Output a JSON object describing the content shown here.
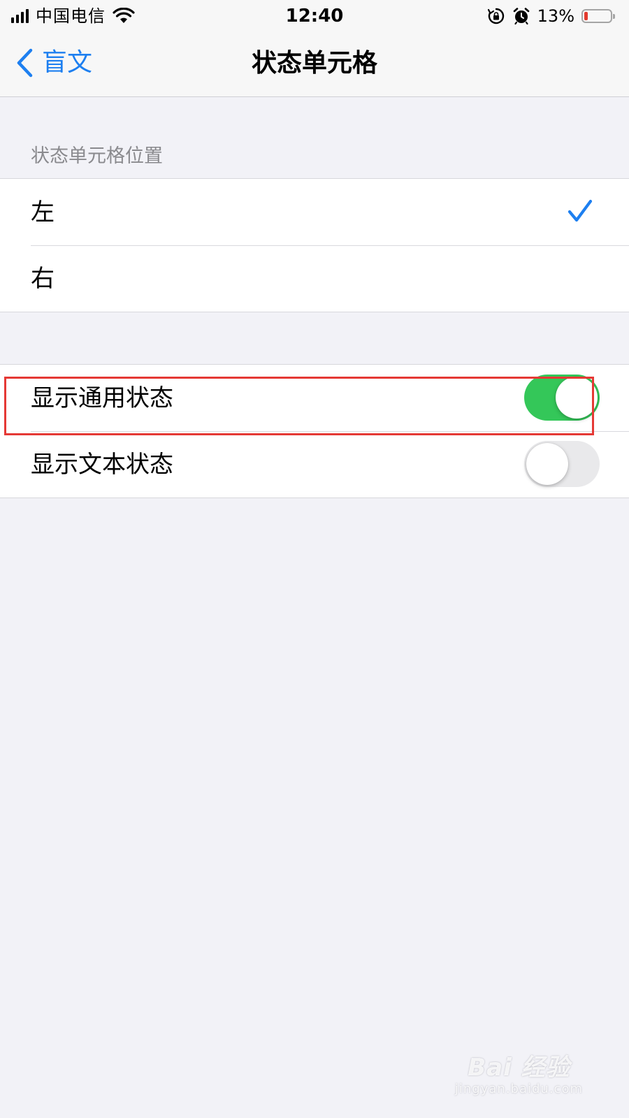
{
  "status_bar": {
    "carrier": "中国电信",
    "time": "12:40",
    "battery_percent": "13%",
    "battery_level": 0.13,
    "battery_color": "#e33a2e",
    "icons": [
      "signal-icon",
      "wifi-icon",
      "orientation-lock-icon",
      "alarm-icon",
      "battery-icon"
    ]
  },
  "nav": {
    "back_label": "盲文",
    "title": "状态单元格",
    "accent_color": "#1d7ff0"
  },
  "position_section": {
    "header": "状态单元格位置",
    "options": [
      {
        "label": "左",
        "selected": true
      },
      {
        "label": "右",
        "selected": false
      }
    ]
  },
  "toggles": [
    {
      "label": "显示通用状态",
      "on": true
    },
    {
      "label": "显示文本状态",
      "on": false
    }
  ],
  "colors": {
    "toggle_on": "#34c759",
    "highlight": "#e53935"
  },
  "watermark": {
    "main": "Bai 经验",
    "sub": "jingyan.baidu.com"
  }
}
